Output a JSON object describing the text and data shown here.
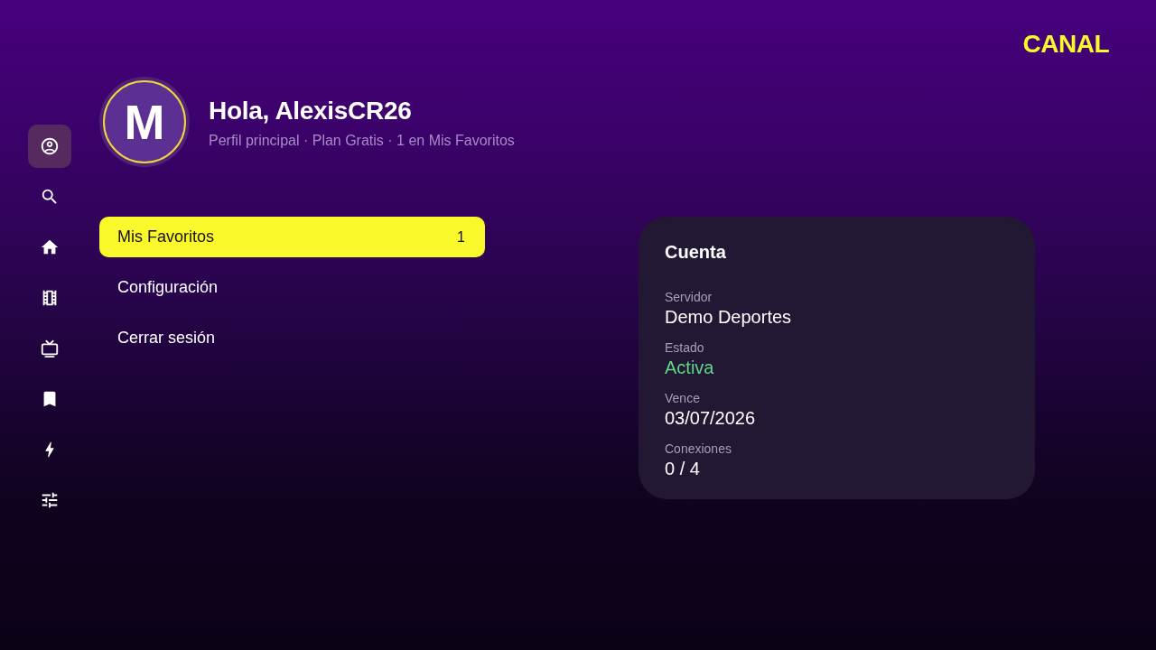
{
  "brand": {
    "logo": "CANAL"
  },
  "sidebar": {
    "items": [
      {
        "kind": "profile",
        "selected": true
      },
      {
        "kind": "search",
        "selected": false
      },
      {
        "kind": "home",
        "selected": false
      },
      {
        "kind": "movies",
        "selected": false
      },
      {
        "kind": "tv",
        "selected": false
      },
      {
        "kind": "bookmark",
        "selected": false
      },
      {
        "kind": "bolt",
        "selected": false
      },
      {
        "kind": "settings",
        "selected": false
      }
    ]
  },
  "profile": {
    "avatar_letter": "M",
    "greeting": "Hola, AlexisCR26",
    "subtitle": "Perfil principal · Plan Gratis · 1 en Mis Favoritos"
  },
  "menu": {
    "items": [
      {
        "label": "Mis Favoritos",
        "count": "1",
        "selected": true
      },
      {
        "label": "Configuración",
        "selected": false
      },
      {
        "label": "Cerrar sesión",
        "selected": false
      }
    ]
  },
  "account_card": {
    "title": "Cuenta",
    "fields": [
      {
        "label": "Servidor",
        "value": "Demo Deportes",
        "kind": "text"
      },
      {
        "label": "Estado",
        "value": "Activa",
        "kind": "status"
      },
      {
        "label": "Vence",
        "value": "03/07/2026",
        "kind": "text"
      },
      {
        "label": "Conexiones",
        "value": "0 / 4",
        "kind": "text"
      }
    ]
  }
}
